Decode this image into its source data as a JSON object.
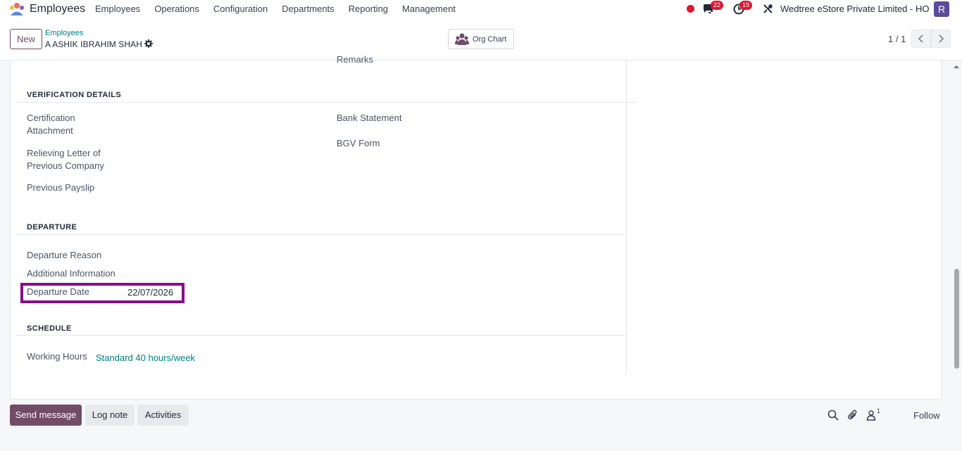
{
  "navbar": {
    "app_name": "Employees",
    "menu": [
      "Employees",
      "Operations",
      "Configuration",
      "Departments",
      "Reporting",
      "Management"
    ],
    "messages_count": "22",
    "activities_count": "19",
    "company": "Wedtree eStore Private Limited - HO",
    "avatar_letter": "R"
  },
  "control_panel": {
    "new_label": "New",
    "breadcrumb_parent": "Employees",
    "record_name": "A ASHIK IBRAHIM SHAH",
    "org_chart_label": "Org Chart",
    "pager": "1 / 1"
  },
  "form": {
    "remarks_label": "Remarks",
    "verification": {
      "title": "VERIFICATION DETAILS",
      "certification_line1": "Certification",
      "certification_line2": "Attachment",
      "relieving_line1": "Relieving Letter of",
      "relieving_line2": "Previous Company",
      "payslip": "Previous Payslip",
      "bank_statement": "Bank Statement",
      "bgv_form": "BGV Form"
    },
    "departure": {
      "title": "DEPARTURE",
      "reason_label": "Departure Reason",
      "info_label": "Additional Information",
      "date_label": "Departure Date",
      "date_value": "22/07/2026"
    },
    "schedule": {
      "title": "SCHEDULE",
      "working_hours_label": "Working Hours",
      "working_hours_value": "Standard 40 hours/week"
    }
  },
  "chatter": {
    "send_message": "Send message",
    "log_note": "Log note",
    "activities": "Activities",
    "followers_count": "1",
    "follow": "Follow"
  },
  "colors": {
    "brand": "#714b67",
    "link": "#017e84",
    "badge": "#e0152f",
    "highlight": "#8a0a8f"
  }
}
